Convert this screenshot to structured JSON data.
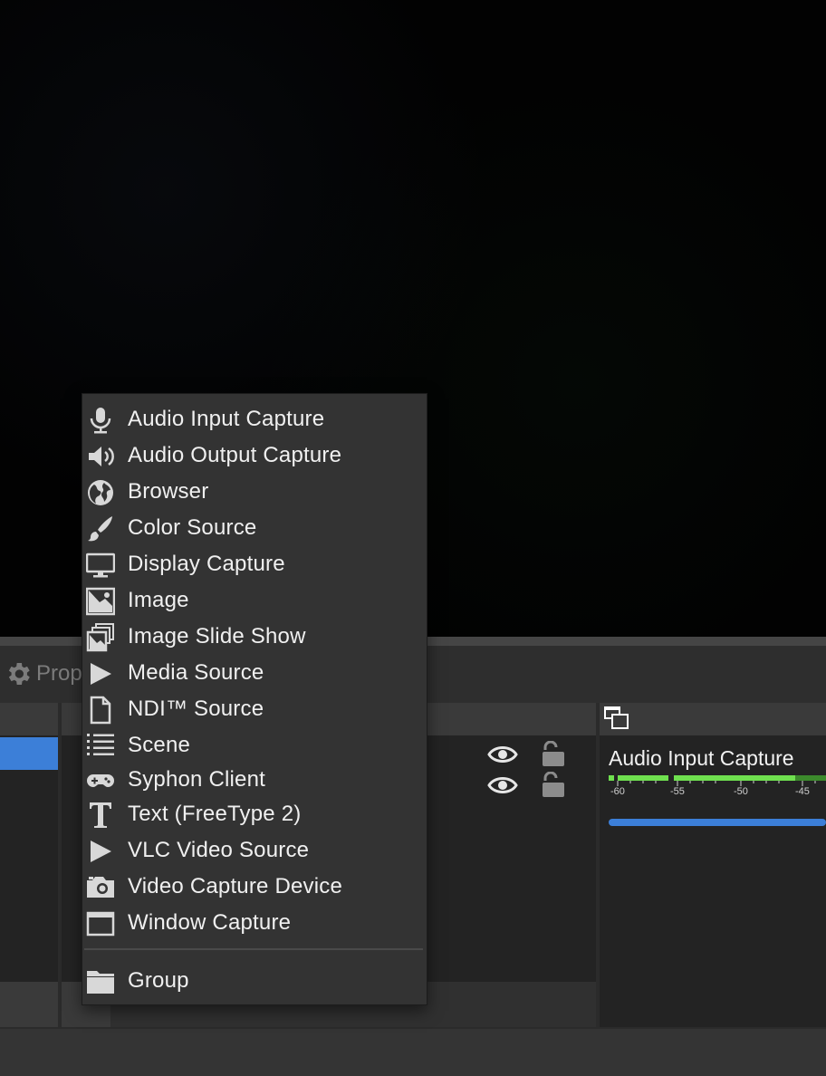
{
  "properties_label": "Prop",
  "menu": {
    "items": [
      {
        "label": "Audio Input Capture",
        "icon": "microphone-icon"
      },
      {
        "label": "Audio Output Capture",
        "icon": "speaker-icon"
      },
      {
        "label": "Browser",
        "icon": "globe-icon"
      },
      {
        "label": "Color Source",
        "icon": "brush-icon"
      },
      {
        "label": "Display Capture",
        "icon": "monitor-icon"
      },
      {
        "label": "Image",
        "icon": "image-icon"
      },
      {
        "label": "Image Slide Show",
        "icon": "slideshow-icon"
      },
      {
        "label": "Media Source",
        "icon": "play-icon"
      },
      {
        "label": "NDI™ Source",
        "icon": "file-icon"
      },
      {
        "label": "Scene",
        "icon": "list-icon"
      },
      {
        "label": "Syphon Client",
        "icon": "gamepad-icon"
      },
      {
        "label": "Text (FreeType 2)",
        "icon": "text-icon"
      },
      {
        "label": "VLC Video Source",
        "icon": "play-icon"
      },
      {
        "label": "Video Capture Device",
        "icon": "camera-icon"
      },
      {
        "label": "Window Capture",
        "icon": "window-icon"
      }
    ],
    "group": {
      "label": "Group",
      "icon": "folder-icon"
    }
  },
  "mixer": {
    "channel_name": "Audio Input Capture",
    "ticks": [
      "-60",
      "-55",
      "-50",
      "-45"
    ],
    "colors": {
      "meter": "#6fe04f",
      "slider": "#3c7fd8"
    }
  },
  "colors": {
    "selection": "#3c7fd8",
    "menu_bg": "#333333"
  }
}
